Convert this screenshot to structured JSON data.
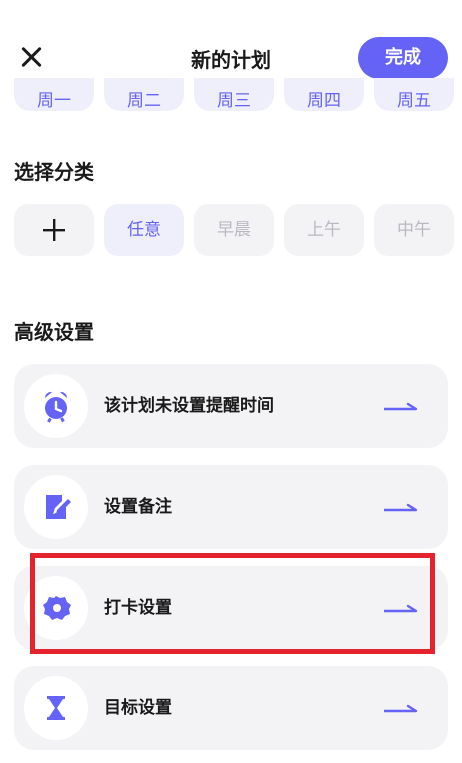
{
  "header": {
    "title": "新的计划",
    "done_label": "完成"
  },
  "weekdays": [
    "周一",
    "周二",
    "周三",
    "周四",
    "周五"
  ],
  "category_section": {
    "title": "选择分类",
    "add_icon": "plus-icon",
    "items": [
      "任意",
      "早晨",
      "上午",
      "中午"
    ],
    "active": "任意"
  },
  "advanced_section": {
    "title": "高级设置",
    "items": [
      {
        "label": "该计划未设置提醒时间",
        "icon": "alarm-clock-icon"
      },
      {
        "label": "设置备注",
        "icon": "note-edit-icon"
      },
      {
        "label": "打卡设置",
        "icon": "gear-icon"
      },
      {
        "label": "目标设置",
        "icon": "hourglass-icon"
      }
    ],
    "highlighted": "打卡设置"
  },
  "colors": {
    "accent": "#6563f6",
    "highlight_border": "#e3232d",
    "row_bg": "#f3f3f6"
  }
}
